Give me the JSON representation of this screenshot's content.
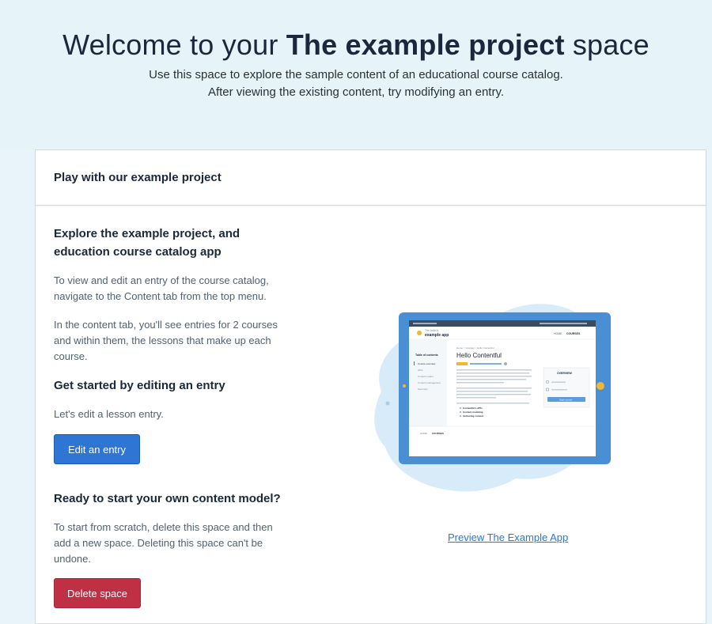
{
  "hero": {
    "title_prefix": "Welcome to your ",
    "title_bold": "The example project",
    "title_suffix": " space",
    "subtitle_line1": "Use this space to explore the sample content of an educational course catalog.",
    "subtitle_line2": "After viewing the existing content, try modifying an entry."
  },
  "card": {
    "header": "Play with our example project",
    "explore_heading_line1": "Explore the example project, and",
    "explore_heading_line2": "education course catalog app",
    "explore_p1_line1": "To view and edit an entry of the course catalog,",
    "explore_p1_line2": "navigate to the Content tab from the top menu.",
    "explore_p2_line1": "In the content tab, you'll see entries for 2 courses",
    "explore_p2_line2": "and within them, the lessons that make up each",
    "explore_p2_line3": "course.",
    "started_heading": "Get started by editing an entry",
    "started_text": "Let's edit a lesson entry.",
    "edit_button": "Edit an entry",
    "ready_heading": "Ready to start your own content model?",
    "ready_line1": "To start from scratch, delete this space and then",
    "ready_line2": "add a new space. Deleting this space can't be",
    "ready_line3": "undone.",
    "delete_button": "Delete space",
    "preview_link": "Preview The Example App"
  },
  "mock_app": {
    "logo_small": "The build it",
    "logo_name": "example app",
    "nav_home": "HOME",
    "nav_courses": "COURSES",
    "breadcrumb": "Home > Courses > Hello Contentful",
    "page_title": "Hello Contentful",
    "toc_title": "Table of contents",
    "toc_items": [
      "Course overview",
      "APIs",
      "Content model",
      "Content management",
      "Summary"
    ],
    "overview_title": "OVERVIEW",
    "start_button": "Start course",
    "bullets": [
      "Contentful's APIs",
      "Content modeling",
      "Authoring content"
    ]
  },
  "colors": {
    "accent": "#2e75d4",
    "danger": "#bf3045",
    "tablet": "#4a8fd4"
  }
}
